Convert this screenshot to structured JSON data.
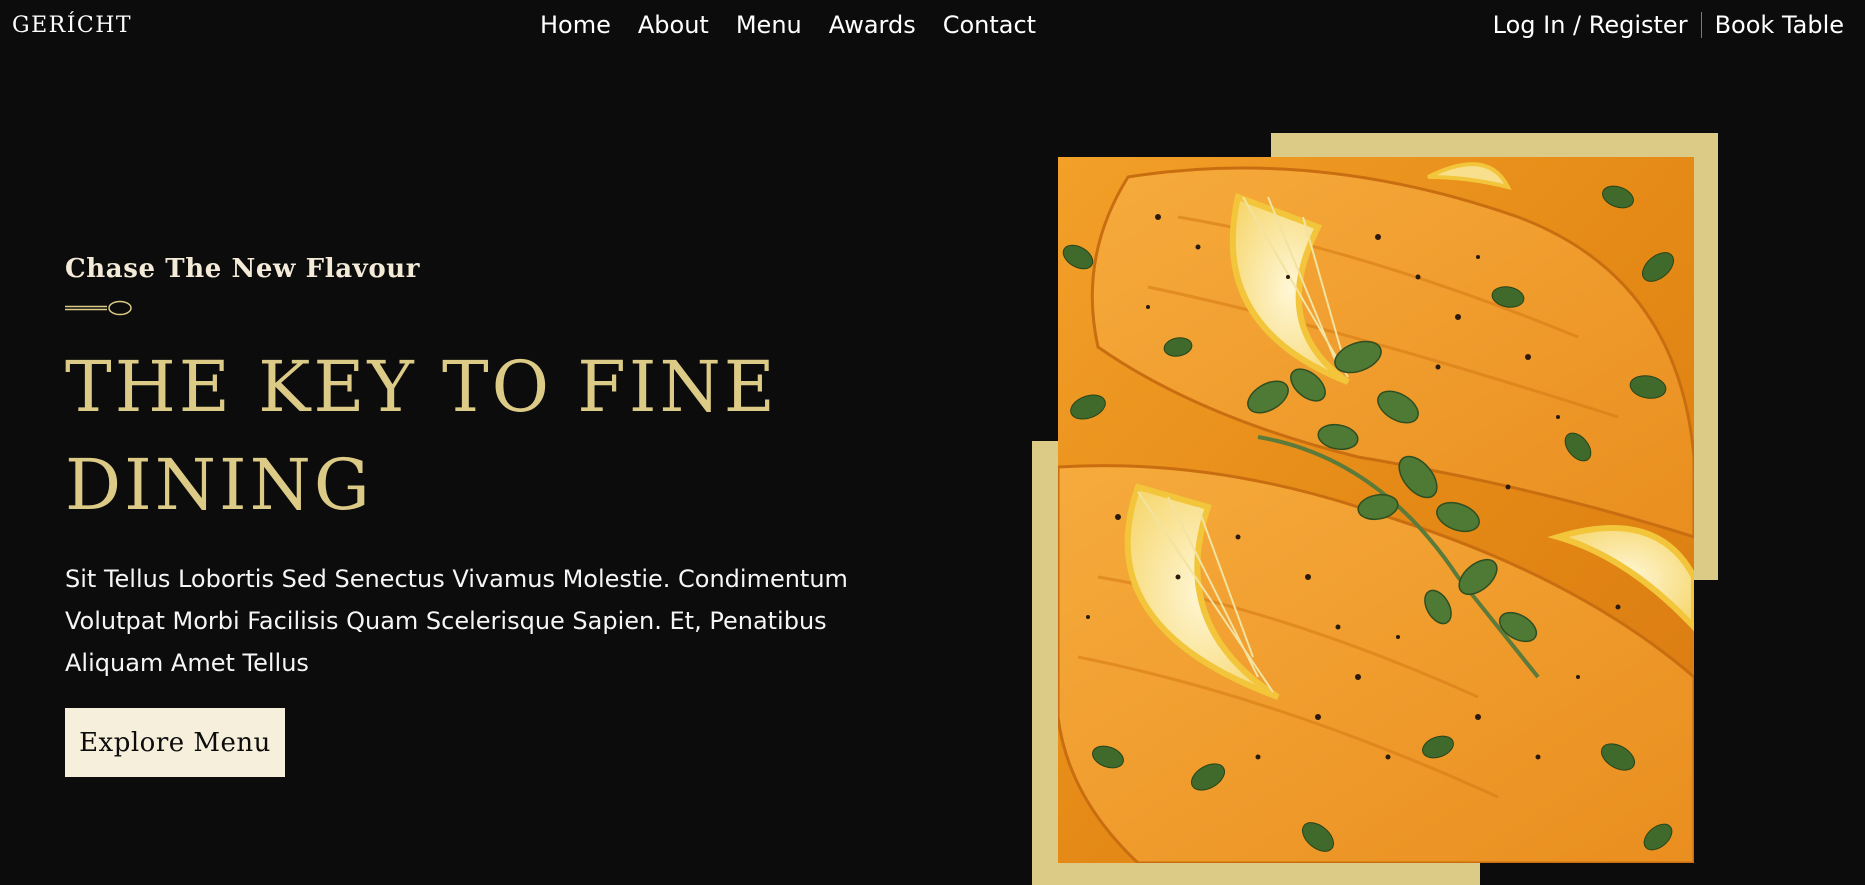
{
  "brand": {
    "logo": "GERÍCHT"
  },
  "nav": {
    "links": [
      "Home",
      "About",
      "Menu",
      "Awards",
      "Contact"
    ],
    "login": "Log In / Register",
    "book": "Book Table"
  },
  "hero": {
    "subtitle": "Chase The New Flavour",
    "headline": "THE KEY TO FINE DINING",
    "description": "Sit Tellus Lobortis Sed Senectus Vivamus Molestie. Condimentum Volutpat Morbi Facilisis Quam Scelerisque Sapien. Et, Penatibus Aliquam Amet Tellus",
    "cta": "Explore Menu"
  },
  "colors": {
    "background": "#0c0c0c",
    "golden": "#dcca87",
    "cream": "#f5efdb",
    "white": "#ffffff"
  },
  "image": {
    "subject": "salmon-dish-photo"
  }
}
